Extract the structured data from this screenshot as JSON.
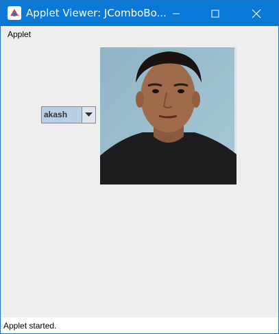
{
  "window": {
    "title": "Applet Viewer: JComboBo...",
    "icon": "java-applet-icon",
    "controls": [
      "minimize-icon",
      "maximize-icon",
      "close-icon"
    ]
  },
  "menubar": {
    "items": [
      {
        "label": "Applet"
      }
    ]
  },
  "combo": {
    "selected": "akash",
    "icon": "chevron-down-icon"
  },
  "photo": {
    "content": "portrait-photo"
  },
  "status": {
    "text": "Applet started."
  },
  "colors": {
    "titlebar": "#0a78d7",
    "combo_background": "#b8cfe5",
    "content_background": "#eeeeee"
  }
}
